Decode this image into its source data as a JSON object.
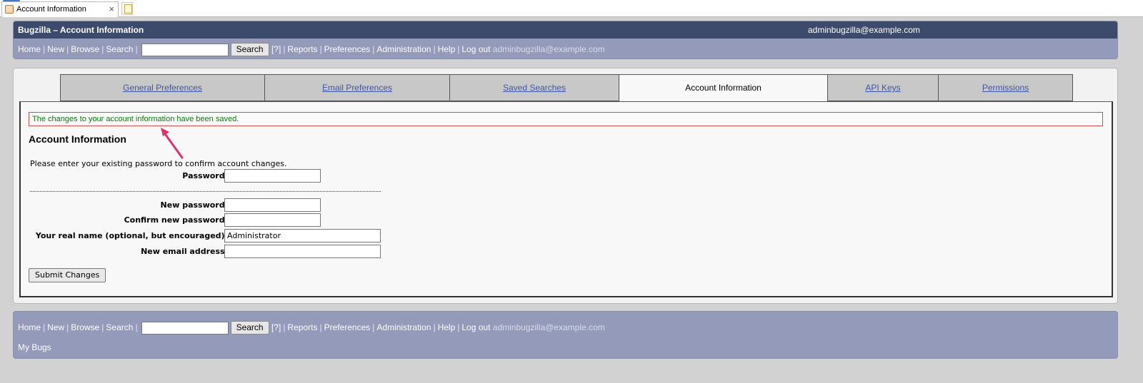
{
  "browser": {
    "tab_title": "Account Information",
    "tab_close": "×"
  },
  "header": {
    "title": "Bugzilla – Account Information",
    "user_email": "adminbugzilla@example.com"
  },
  "nav": {
    "home": "Home",
    "new": "New",
    "browse": "Browse",
    "search": "Search",
    "search_button": "Search",
    "help_q": "[?]",
    "reports": "Reports",
    "preferences": "Preferences",
    "administration": "Administration",
    "help": "Help",
    "logout": "Log out",
    "logout_user": "adminbugzilla@example.com",
    "separator": "|"
  },
  "tabs": [
    {
      "label": "General Preferences"
    },
    {
      "label": "Email Preferences"
    },
    {
      "label": "Saved Searches"
    },
    {
      "label": "Account Information"
    },
    {
      "label": "API Keys"
    },
    {
      "label": "Permissions"
    }
  ],
  "message": "The changes to your account information have been saved.",
  "section_title": "Account Information",
  "form": {
    "intro": "Please enter your existing password to confirm account changes.",
    "password_label": "Password:",
    "password_value": "",
    "new_password_label": "New password:",
    "new_password_value": "",
    "confirm_password_label": "Confirm new password:",
    "confirm_password_value": "",
    "real_name_label": "Your real name (optional, but encouraged):",
    "real_name_value": "Administrator",
    "new_email_label": "New email address:",
    "new_email_value": "",
    "submit_label": "Submit Changes"
  },
  "footer": {
    "my_bugs": "My Bugs"
  },
  "colors": {
    "title_bar": "#3c4a6c",
    "link_bar": "#949aba",
    "message_text": "#0a7a0a",
    "message_border": "#d64b4b",
    "arrow": "#e0306a"
  }
}
